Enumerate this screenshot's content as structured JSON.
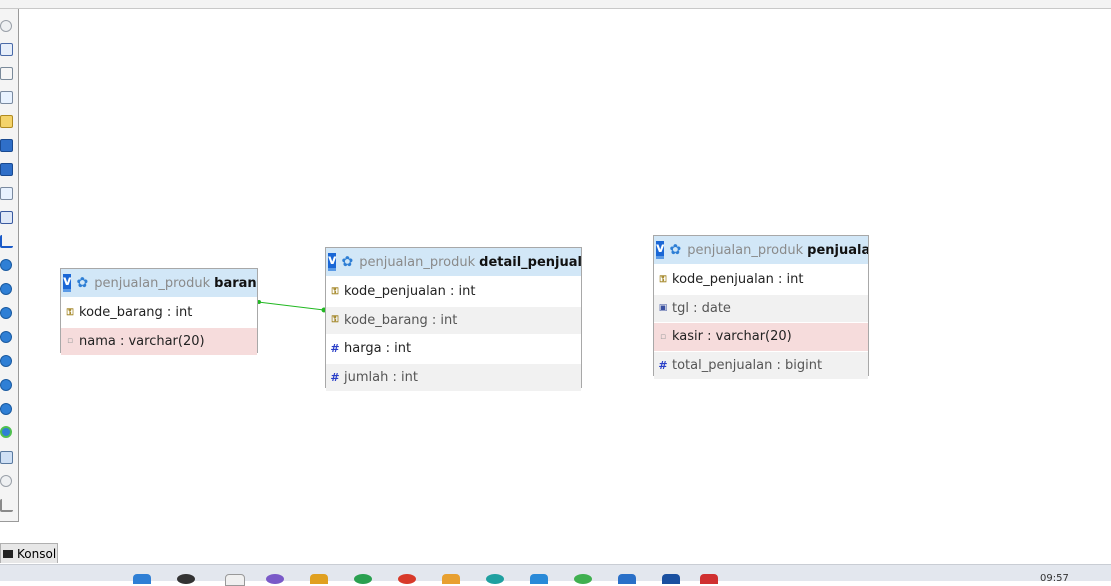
{
  "db_name": "penjualan_produk",
  "tables": [
    {
      "name": "barang",
      "columns": [
        {
          "text": "kode_barang : int",
          "icon": "key-icon"
        },
        {
          "text": "nama : varchar(20)",
          "icon": "nullable-icon"
        }
      ]
    },
    {
      "name": "detail_penjualan",
      "columns": [
        {
          "text": "kode_penjualan : int",
          "icon": "key-icon"
        },
        {
          "text": "kode_barang : int",
          "icon": "key-icon"
        },
        {
          "text": "harga : int",
          "icon": "hash-icon"
        },
        {
          "text": "jumlah : int",
          "icon": "hash-icon"
        }
      ]
    },
    {
      "name": "penjualan",
      "columns": [
        {
          "text": "kode_penjualan : int",
          "icon": "key-icon"
        },
        {
          "text": "tgl : date",
          "icon": "date-icon"
        },
        {
          "text": "kasir : varchar(20)",
          "icon": "nullable-icon"
        },
        {
          "text": "total_penjualan : bigint",
          "icon": "hash-icon"
        }
      ]
    }
  ],
  "toggle_label": "v",
  "konsol_label": "Konsol",
  "clock": "09:57",
  "colors": {
    "header": "#d2e7f7",
    "relation_line": "#22b822",
    "toggle": "#1a67d6"
  }
}
